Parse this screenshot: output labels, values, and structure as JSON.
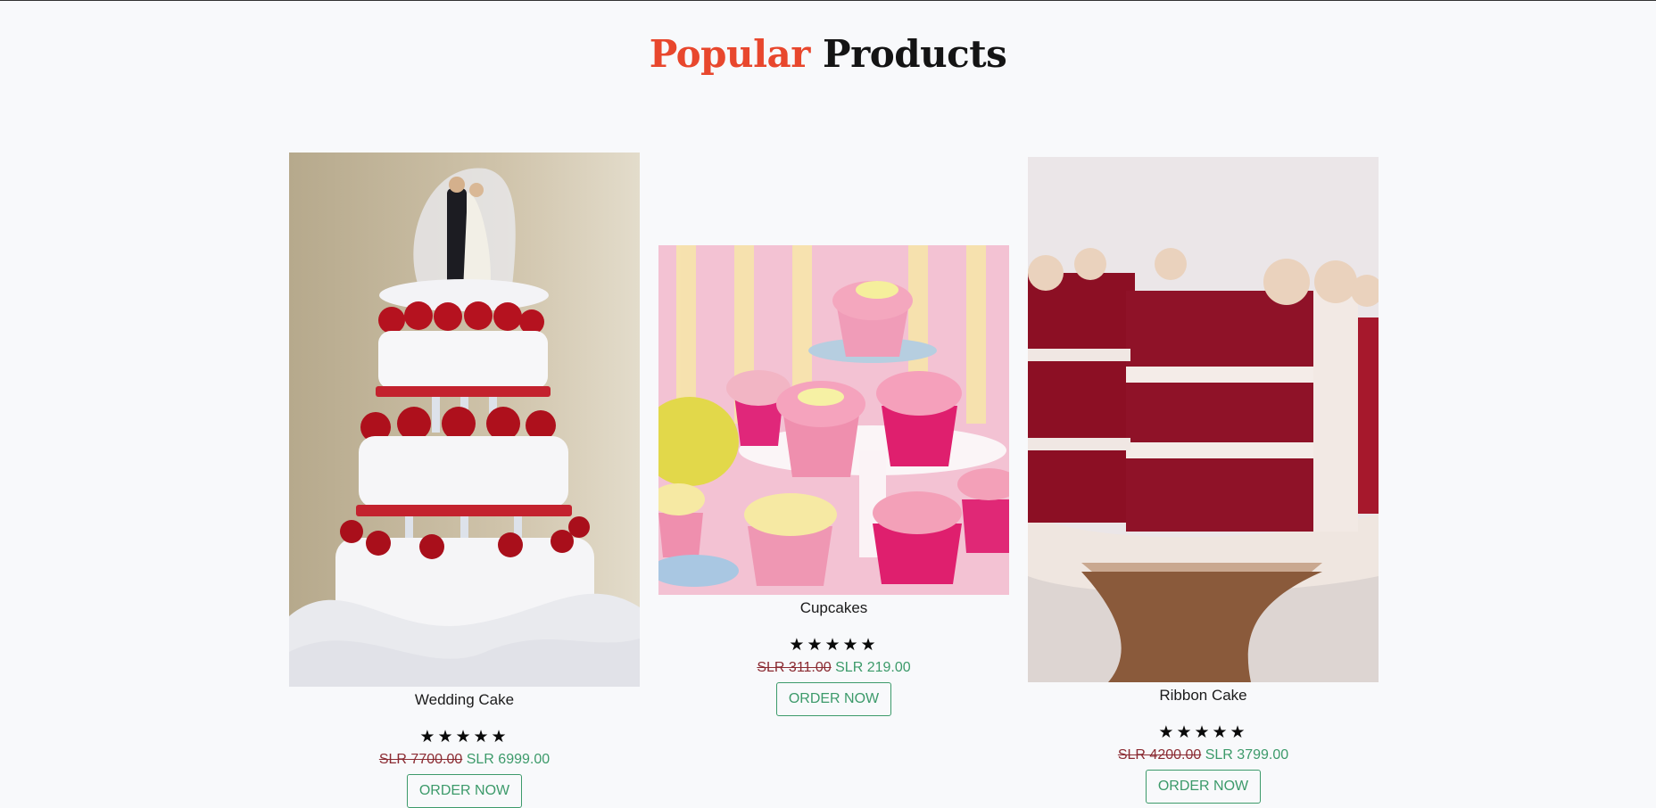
{
  "section": {
    "title_accent": "Popular",
    "title_rest": "Products"
  },
  "products": [
    {
      "name": "Wedding Cake",
      "stars": "★★★★★",
      "rating": 5,
      "old_price": "SLR 7700.00",
      "new_price": "SLR 6999.00",
      "cta": "ORDER NOW"
    },
    {
      "name": "Cupcakes",
      "stars": "★★★★★",
      "rating": 5,
      "old_price": "SLR 311.00",
      "new_price": "SLR 219.00",
      "cta": "ORDER NOW"
    },
    {
      "name": "Ribbon Cake",
      "stars": "★★★★★",
      "rating": 5,
      "old_price": "SLR 4200.00",
      "new_price": "SLR 3799.00",
      "cta": "ORDER NOW"
    }
  ],
  "colors": {
    "accent": "#e8472d",
    "price_new": "#3c9a6a",
    "price_old": "#8b2b32",
    "background": "#f8f9fb"
  }
}
